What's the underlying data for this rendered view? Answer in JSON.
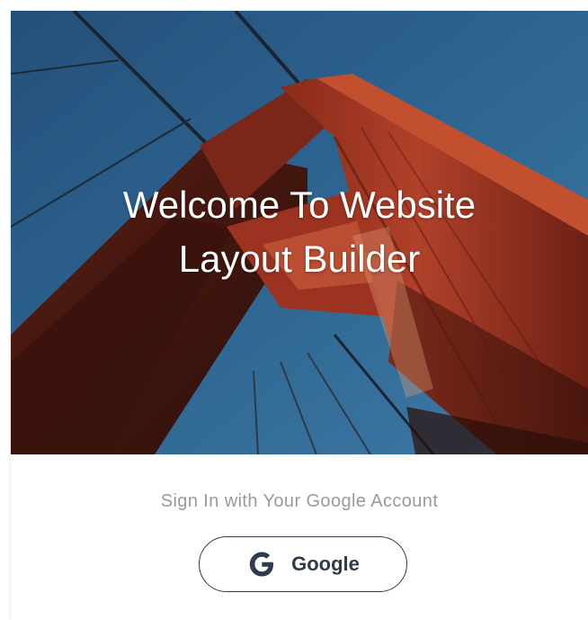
{
  "hero": {
    "title_line1": "Welcome To Website",
    "title_line2": "Layout Builder",
    "image_description_icon": "bridge-tower-photo"
  },
  "signin": {
    "prompt": "Sign In with Your Google Account",
    "button_label": "Google",
    "button_icon": "google-g-icon"
  },
  "colors": {
    "title_text": "#ffffff",
    "prompt_text": "#9a9a9a",
    "button_border": "#2f3b4a",
    "button_text": "#2f3b4a"
  }
}
